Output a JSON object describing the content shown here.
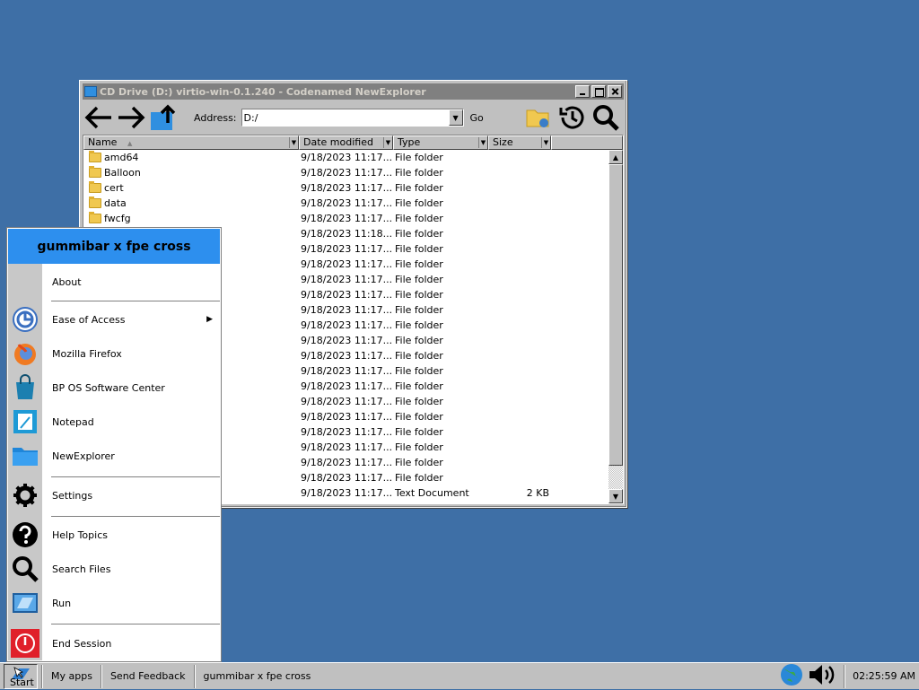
{
  "window": {
    "title": "CD Drive (D:) virtio-win-0.1.240 - Codenamed NewExplorer",
    "address_label": "Address:",
    "address_value": "D:/",
    "go_label": "Go"
  },
  "columns": {
    "name": "Name",
    "date": "Date modified",
    "type": "Type",
    "size": "Size"
  },
  "files": [
    {
      "name": "amd64",
      "date": "9/18/2023 11:17...",
      "type": "File folder",
      "size": ""
    },
    {
      "name": "Balloon",
      "date": "9/18/2023 11:17...",
      "type": "File folder",
      "size": ""
    },
    {
      "name": "cert",
      "date": "9/18/2023 11:17...",
      "type": "File folder",
      "size": ""
    },
    {
      "name": "data",
      "date": "9/18/2023 11:17...",
      "type": "File folder",
      "size": ""
    },
    {
      "name": "fwcfg",
      "date": "9/18/2023 11:17...",
      "type": "File folder",
      "size": ""
    },
    {
      "name": "",
      "date": "9/18/2023 11:18...",
      "type": "File folder",
      "size": ""
    },
    {
      "name": "",
      "date": "9/18/2023 11:17...",
      "type": "File folder",
      "size": ""
    },
    {
      "name": "",
      "date": "9/18/2023 11:17...",
      "type": "File folder",
      "size": ""
    },
    {
      "name": "",
      "date": "9/18/2023 11:17...",
      "type": "File folder",
      "size": ""
    },
    {
      "name": "",
      "date": "9/18/2023 11:17...",
      "type": "File folder",
      "size": ""
    },
    {
      "name": "",
      "date": "9/18/2023 11:17...",
      "type": "File folder",
      "size": ""
    },
    {
      "name": "",
      "date": "9/18/2023 11:17...",
      "type": "File folder",
      "size": ""
    },
    {
      "name": "",
      "date": "9/18/2023 11:17...",
      "type": "File folder",
      "size": ""
    },
    {
      "name": "",
      "date": "9/18/2023 11:17...",
      "type": "File folder",
      "size": ""
    },
    {
      "name": "",
      "date": "9/18/2023 11:17...",
      "type": "File folder",
      "size": ""
    },
    {
      "name": "",
      "date": "9/18/2023 11:17...",
      "type": "File folder",
      "size": ""
    },
    {
      "name": "",
      "date": "9/18/2023 11:17...",
      "type": "File folder",
      "size": ""
    },
    {
      "name": "",
      "date": "9/18/2023 11:17...",
      "type": "File folder",
      "size": ""
    },
    {
      "name": "",
      "date": "9/18/2023 11:17...",
      "type": "File folder",
      "size": ""
    },
    {
      "name": "",
      "date": "9/18/2023 11:17...",
      "type": "File folder",
      "size": ""
    },
    {
      "name": "",
      "date": "9/18/2023 11:17...",
      "type": "File folder",
      "size": ""
    },
    {
      "name": "",
      "date": "9/18/2023 11:17...",
      "type": "File folder",
      "size": ""
    },
    {
      "name": "",
      "date": "9/18/2023 11:17...",
      "type": "Text Document",
      "size": "2 KB"
    }
  ],
  "start_menu": {
    "header": "gummibar x fpe cross",
    "items": [
      {
        "label": "About",
        "icon": "none"
      },
      {
        "label": "Ease of Access",
        "icon": "accessibility-icon",
        "submenu": "▶"
      },
      {
        "label": "Mozilla Firefox",
        "icon": "firefox-icon"
      },
      {
        "label": "BP OS Software Center",
        "icon": "shopping-bag-icon"
      },
      {
        "label": "Notepad",
        "icon": "notepad-icon"
      },
      {
        "label": "NewExplorer",
        "icon": "folder-icon"
      },
      {
        "label": "Settings",
        "icon": "gear-icon"
      },
      {
        "label": "Help Topics",
        "icon": "help-icon"
      },
      {
        "label": "Search Files",
        "icon": "search-icon"
      },
      {
        "label": "Run",
        "icon": "run-icon"
      },
      {
        "label": "End Session",
        "icon": "power-icon"
      }
    ]
  },
  "taskbar": {
    "start_label": "Start",
    "buttons": [
      "My apps",
      "Send Feedback",
      "gummibar x fpe cross"
    ],
    "clock": "02:25:59 AM"
  },
  "colors": {
    "desktop": "#3e6fa6",
    "start_header": "#2d8fee",
    "power_red": "#e0202a"
  }
}
